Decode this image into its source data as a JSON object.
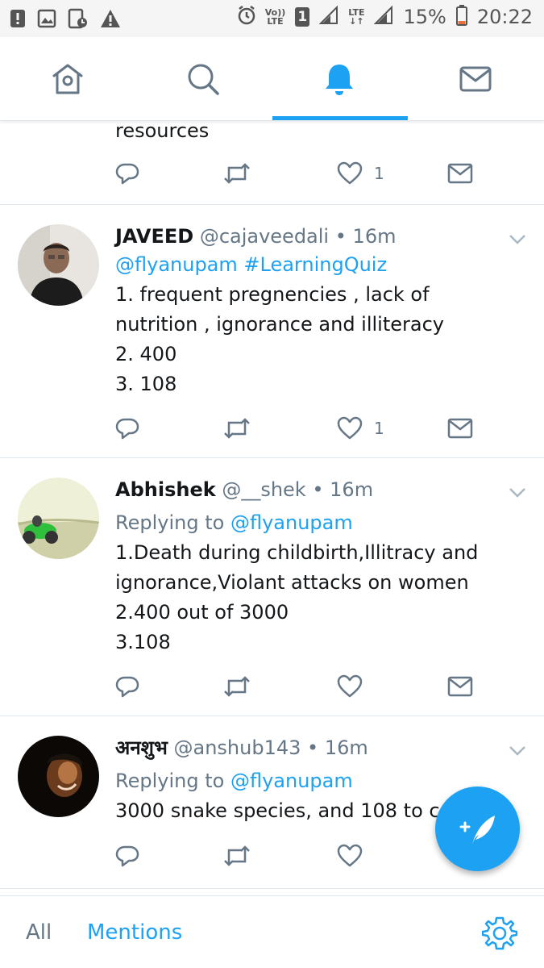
{
  "status_bar": {
    "volte_top": "Vo))",
    "volte_bottom": "LTE",
    "sim_number": "1",
    "lte_top": "LTE",
    "lte_bottom": "↓↑",
    "battery_percent": "15%",
    "time": "20:22",
    "icons": [
      "alert-icon",
      "image-icon",
      "storage-icon",
      "warning-icon",
      "alarm-icon",
      "signal-icon",
      "battery-icon"
    ]
  },
  "nav": {
    "tabs": [
      "home-icon",
      "search-icon",
      "notifications-icon",
      "messages-icon"
    ],
    "active_tab": 2,
    "accent": "#1da1f2"
  },
  "tweets": [
    {
      "partial": true,
      "body": [
        "resources"
      ],
      "actions": {
        "likes": "1"
      }
    },
    {
      "name": "JAVEED",
      "handle": "@cajaveedali",
      "dot": "•",
      "time": "16m",
      "mention_line": "@flyanupam #LearningQuiz",
      "body": [
        "1. frequent pregnencies , lack of",
        "nutrition , ignorance and illiteracy",
        "2. 400",
        "3. 108"
      ],
      "actions": {
        "likes": "1"
      }
    },
    {
      "name": "Abhishek",
      "handle": "@__shek",
      "dot": "•",
      "time": "16m",
      "replying_prefix": "Replying to",
      "replying_to": "@flyanupam",
      "body": [
        "1.Death during childbirth,Illitracy and",
        "ignorance,Violant attacks on women",
        "2.400 out of 3000",
        "3.108"
      ],
      "actions": {
        "likes": ""
      }
    },
    {
      "name": "अनशुभ",
      "handle": "@anshub143",
      "dot": "•",
      "time": "16m",
      "replying_prefix": "Replying to",
      "replying_to": "@flyanupam",
      "body": [
        "3000 snake species,  and 108 to cal"
      ],
      "actions": {
        "likes": ""
      }
    }
  ],
  "bottom_bar": {
    "tab_all": "All",
    "tab_mentions": "Mentions",
    "settings_icon": "gear-icon"
  },
  "colors": {
    "accent": "#1da1f2",
    "secondary_text": "#657786",
    "divider": "#e1e8ed"
  }
}
